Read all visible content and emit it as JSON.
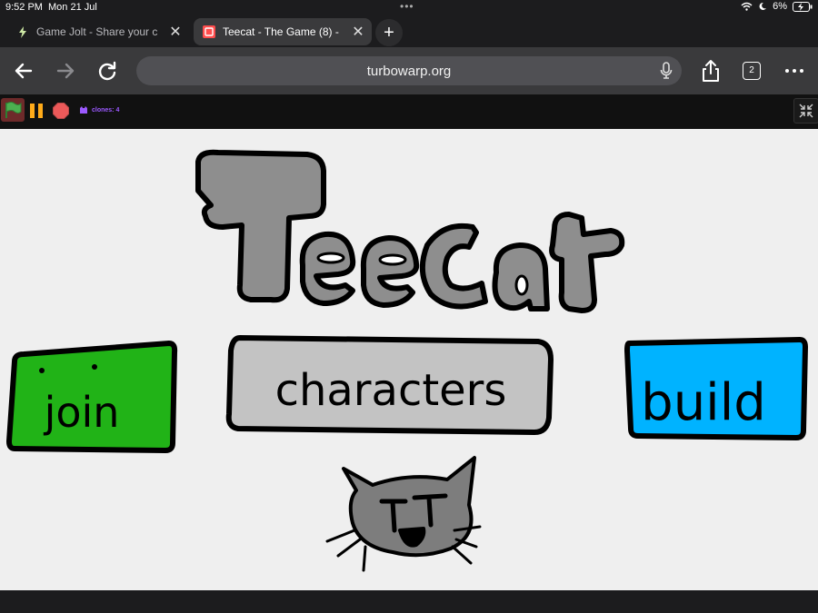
{
  "status_bar": {
    "time": "9:52 PM",
    "date": "Mon 21 Jul",
    "battery": "6%"
  },
  "tabs": [
    {
      "title": "Game Jolt - Share your c",
      "icon": "gamejolt-bolt-icon",
      "active": false
    },
    {
      "title": "Teecat - The Game (8) -",
      "icon": "turbowarp-icon",
      "active": true
    }
  ],
  "toolbar": {
    "url": "turbowarp.org",
    "tab_count": "2"
  },
  "turbowarp": {
    "clones_label": "clones: 4"
  },
  "game": {
    "title": "Teecat",
    "buttons": [
      {
        "label": "join",
        "color": "#21b317"
      },
      {
        "label": "characters",
        "color": "#c3c3c3"
      },
      {
        "label": "build",
        "color": "#00b3ff"
      }
    ]
  },
  "colors": {
    "title_fill": "#8e8e8e",
    "cat_fill": "#7d7d7d",
    "stage_bg": "#efefef"
  }
}
